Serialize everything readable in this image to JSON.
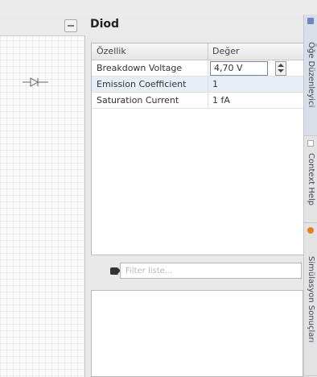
{
  "panel": {
    "title": "Diod"
  },
  "properties": {
    "header": {
      "property": "Özellik",
      "value": "Değer"
    },
    "rows": [
      {
        "name": "Breakdown Voltage",
        "value": "4,70 V"
      },
      {
        "name": "Emission Coefficient",
        "value": "1"
      },
      {
        "name": "Saturation Current",
        "value": "1 fA"
      }
    ]
  },
  "filter": {
    "placeholder": "Filter liste..."
  },
  "side_tabs": [
    {
      "label": "Öğe Düzenleyici"
    },
    {
      "label": "Context Help"
    },
    {
      "label": "Simülasyon Sonuçları"
    }
  ],
  "colors": {
    "accent": "#6b86c6",
    "selected_row": "#e9eef6",
    "tab_orange": "#e8801a"
  }
}
